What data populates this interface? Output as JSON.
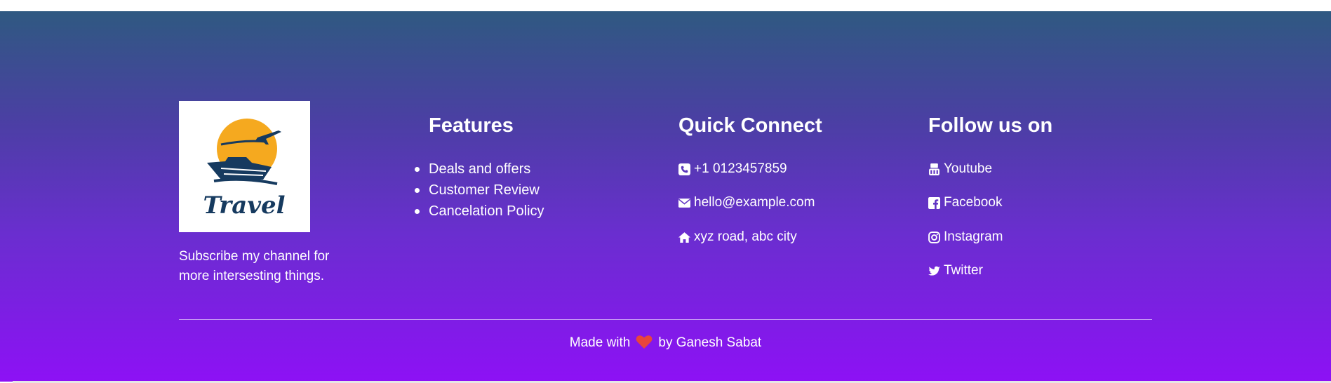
{
  "brand": {
    "logo_text": "Travel",
    "tagline": "Subscribe my channel for more intersesting things."
  },
  "features": {
    "heading": "Features",
    "items": [
      "Deals and offers",
      "Customer Review",
      "Cancelation Policy"
    ]
  },
  "quick_connect": {
    "heading": "Quick Connect",
    "items": [
      {
        "icon": "phone-icon",
        "text": "+1 0123457859"
      },
      {
        "icon": "envelope-icon",
        "text": "hello@example.com"
      },
      {
        "icon": "home-icon",
        "text": "xyz road, abc city"
      }
    ]
  },
  "follow": {
    "heading": "Follow us on",
    "items": [
      {
        "icon": "youtube-icon",
        "text": "Youtube"
      },
      {
        "icon": "facebook-icon",
        "text": "Facebook"
      },
      {
        "icon": "instagram-icon",
        "text": "Instagram"
      },
      {
        "icon": "twitter-icon",
        "text": "Twitter"
      }
    ]
  },
  "credit": {
    "prefix": "Made with",
    "suffix": "by Ganesh Sabat",
    "heart_color": "#e8453c"
  },
  "colors": {
    "gradient_top": "#2f5981",
    "gradient_bottom": "#8d11f5",
    "logo_sun": "#f5a91f",
    "logo_navy": "#163a5f"
  }
}
